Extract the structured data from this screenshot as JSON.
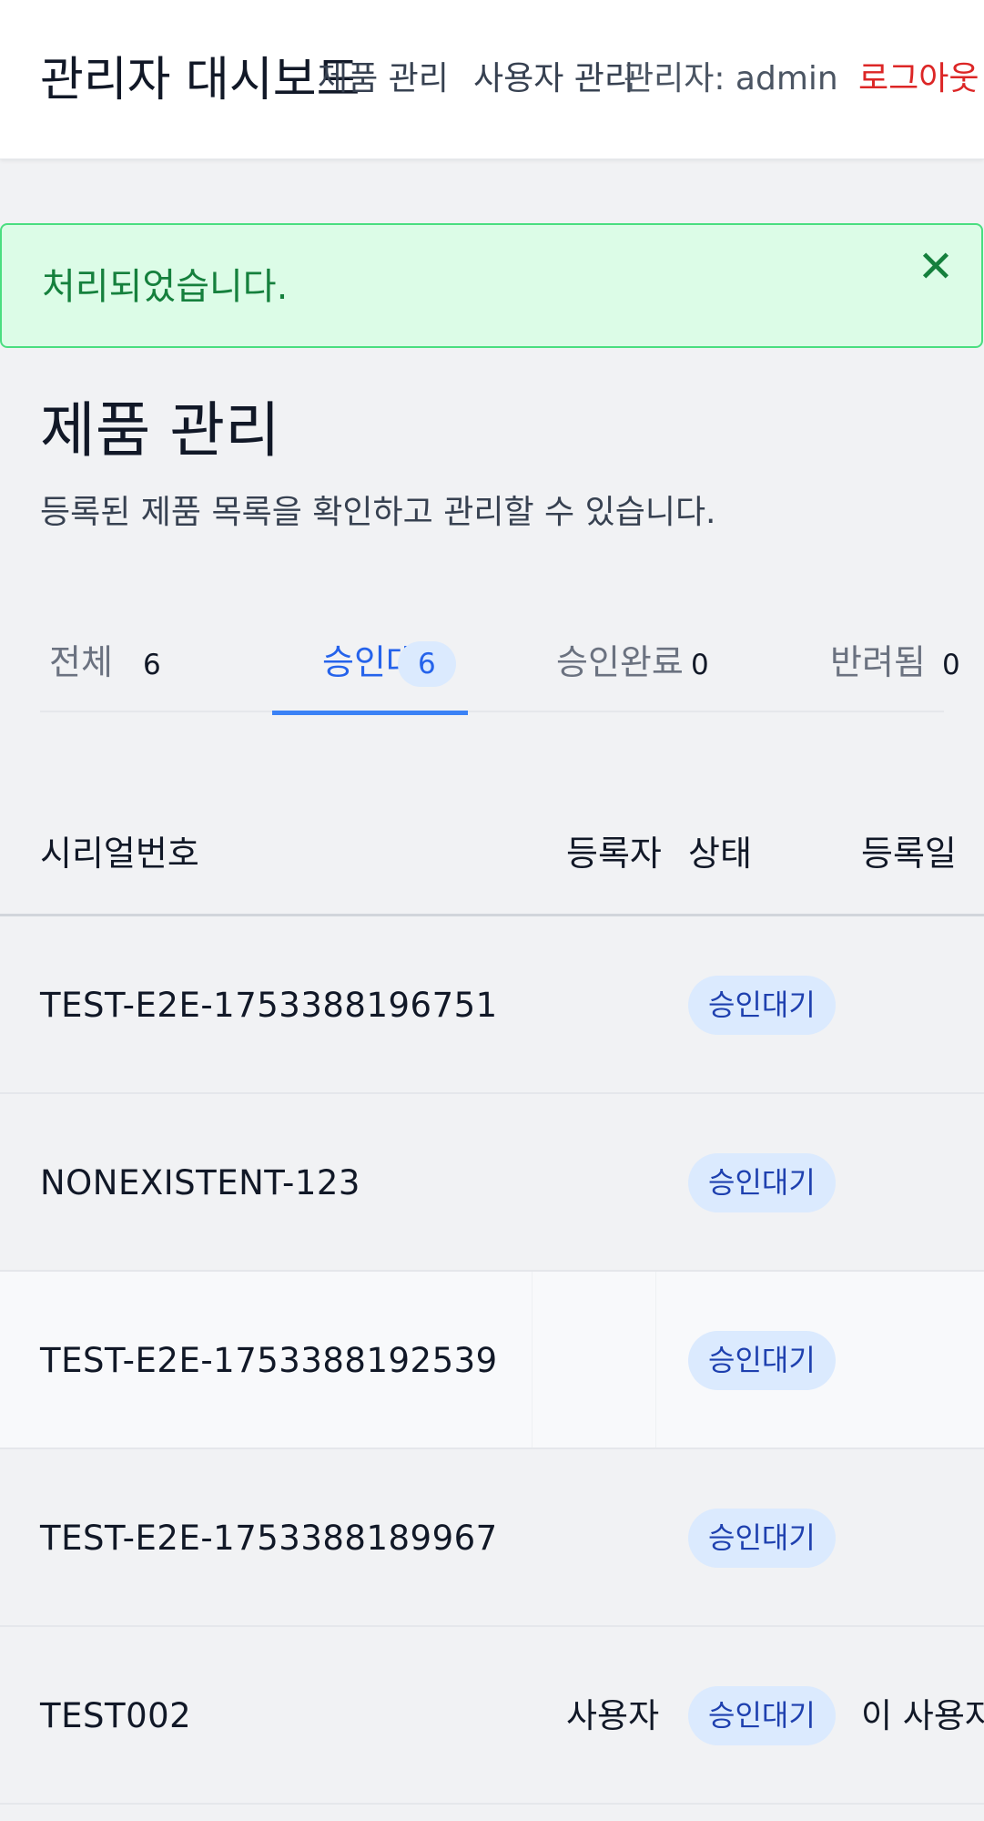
{
  "header": {
    "brand": "관리자 대시보드",
    "nav": [
      "제품 관리",
      "사용자 관리"
    ],
    "user": "관리자: admin",
    "logout": "로그아웃"
  },
  "alert": {
    "message": "처리되었습니다.",
    "close_icon": "close-icon",
    "close_symbol": "✕"
  },
  "page": {
    "title": "제품 관리",
    "description": "등록된 제품 목록을 확인하고 관리할 수 있습니다."
  },
  "tabs": [
    {
      "label": "전체",
      "count": "6"
    },
    {
      "label": "승인대기",
      "count": "6"
    },
    {
      "label": "승인완료",
      "count": "0"
    },
    {
      "label": "반려됨",
      "count": "0"
    }
  ],
  "active_tab": "승인대기",
  "table": {
    "headers": [
      "시리얼번호",
      "등록자",
      "상태",
      "등록일"
    ],
    "rows": [
      {
        "serial": "TEST-E2E-1753388196751",
        "user": "",
        "status": "승인대기",
        "extra": ""
      },
      {
        "serial": "NONEXISTENT-123",
        "user": "",
        "status": "승인대기",
        "extra": ""
      },
      {
        "serial": "TEST-E2E-1753388192539",
        "user": "",
        "status": "승인대기",
        "extra": ""
      },
      {
        "serial": "TEST-E2E-1753388189967",
        "user": "",
        "status": "승인대기",
        "extra": ""
      },
      {
        "serial": "TEST002",
        "user": "사용자",
        "status": "승인대기",
        "extra": "이 사용자 (I"
      }
    ]
  },
  "colors": {
    "accent": "#3b82f6",
    "success_bg": "#dcfce7",
    "success_text": "#15803d",
    "danger": "#dc2626",
    "badge_bg": "#dbeafe",
    "badge_text": "#1e40af"
  }
}
